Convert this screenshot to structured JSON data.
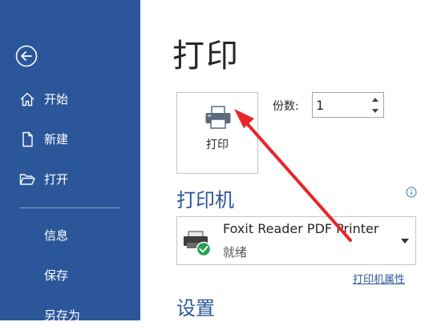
{
  "sidebar": {
    "items": [
      {
        "label": "开始",
        "icon": "home-icon"
      },
      {
        "label": "新建",
        "icon": "new-document-icon"
      },
      {
        "label": "打开",
        "icon": "open-folder-icon"
      },
      {
        "label": "信息"
      },
      {
        "label": "保存"
      },
      {
        "label": "另存为"
      }
    ]
  },
  "main": {
    "page_title": "打印",
    "print_button_label": "打印",
    "copies_label": "份数:",
    "copies_value": "1",
    "printer_section_title": "打印机",
    "printer": {
      "name": "Foxit Reader PDF Printer",
      "status": "就绪"
    },
    "printer_properties_link": "打印机属性",
    "settings_section_title": "设置"
  },
  "colors": {
    "sidebar_bg": "#2b579a",
    "accent": "#2b579a",
    "annotation_arrow": "#e8262a",
    "ready_check": "#22a34a"
  }
}
